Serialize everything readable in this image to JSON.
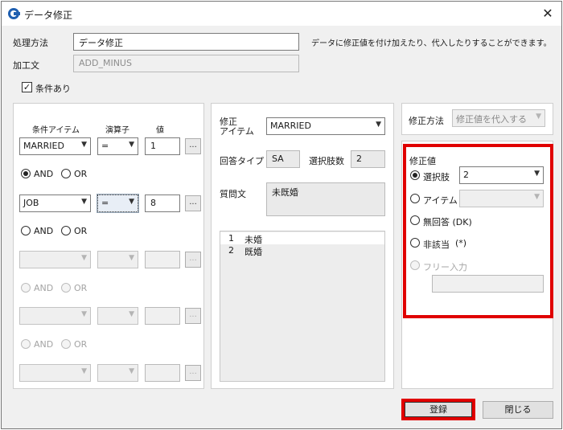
{
  "window": {
    "title": "データ修正",
    "close_glyph": "✕"
  },
  "top": {
    "process_label": "処理方法",
    "process_value": "データ修正",
    "description": "データに修正値を付け加えたり、代入したりすることができます。",
    "kakou_label": "加工文",
    "kakou_value": "ADD_MINUS",
    "condition_check_label": "条件あり"
  },
  "conditions": {
    "headers": {
      "item": "条件アイテム",
      "operator": "演算子",
      "value": "値"
    },
    "rows": [
      {
        "item": "MARRIED",
        "operator": "=",
        "value": "1"
      },
      {
        "item": "JOB",
        "operator": "=",
        "value": "8"
      },
      {
        "item": "",
        "operator": "",
        "value": ""
      },
      {
        "item": "",
        "operator": "",
        "value": ""
      },
      {
        "item": "",
        "operator": "",
        "value": ""
      }
    ],
    "and_label": "AND",
    "or_label": "OR",
    "ellipsis": "..."
  },
  "middle": {
    "item_label": "修正\nアイテム",
    "item_label_l1": "修正",
    "item_label_l2": "アイテム",
    "item_value": "MARRIED",
    "answer_type_label": "回答タイプ",
    "answer_type_value": "SA",
    "choice_count_label": "選択肢数",
    "choice_count_value": "2",
    "question_label": "質問文",
    "question_value": "未既婚",
    "choices": [
      {
        "num": "1",
        "text": "未婚"
      },
      {
        "num": "2",
        "text": "既婚"
      }
    ]
  },
  "right": {
    "method_label": "修正方法",
    "method_value": "修正値を代入する",
    "value_group_label": "修正値",
    "option_choice": "選択肢",
    "option_choice_value": "2",
    "option_item": "アイテム",
    "option_no_answer": "無回答 (DK)",
    "option_not_applicable": "非該当",
    "option_not_applicable_mark": "(*)",
    "option_free_input": "フリー入力"
  },
  "footer": {
    "register": "登録",
    "close": "閉じる"
  },
  "colors": {
    "highlight": "#e00000"
  }
}
